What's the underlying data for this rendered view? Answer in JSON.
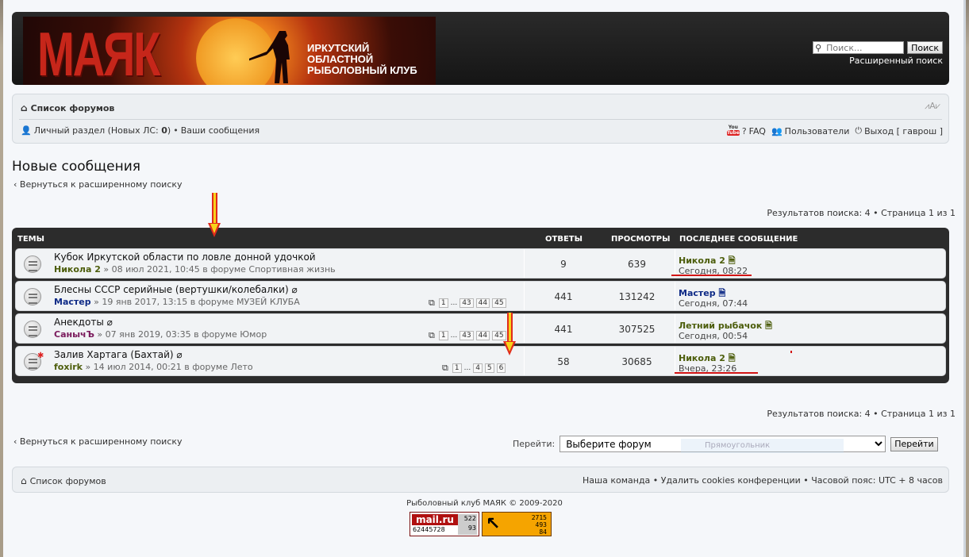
{
  "header": {
    "logo_text": "МАЯК",
    "club_line1": "ИРКУТСКИЙ ОБЛАСТНОЙ",
    "club_line2": "РЫБОЛОВНЫЙ КЛУБ",
    "search_placeholder": "Поиск...",
    "search_button": "Поиск",
    "advanced_search": "Расширенный поиск"
  },
  "nav": {
    "forum_list": "Список форумов",
    "font_control": "⩘A⩗",
    "private_section": "Личный раздел (Новых ЛС: ",
    "pm_count": "0",
    "private_close": ")",
    "bullet": "•",
    "your_posts": "Ваши сообщения",
    "youtube_top": "You",
    "youtube_bottom": "Tube",
    "faq": "FAQ",
    "users": "Пользователи",
    "logout": "Выход [ гаврош ]"
  },
  "page": {
    "title": "Новые сообщения",
    "back_link": "Вернуться к расширенному поиску",
    "results": "Результатов поиска: 4 • Страница 1 из 1"
  },
  "table": {
    "headers": {
      "topics": "ТЕМЫ",
      "replies": "ОТВЕТЫ",
      "views": "ПРОСМОТРЫ",
      "last_post": "ПОСЛЕДНЕЕ СООБЩЕНИЕ"
    },
    "rows": [
      {
        "title": "Кубок Иркутской области по ловле донной удочкой",
        "author": "Никола 2",
        "author_color": "#4c5d0b",
        "info": " » 08 июл 2021, 10:45 в форуме Спортивная жизнь",
        "pages": [],
        "replies": "9",
        "views": "639",
        "last_author": "Никола 2",
        "last_author_color": "#4c5d0b",
        "last_time": "Сегодня, 08:22"
      },
      {
        "title": "Блесны СССР серийные (вертушки/колебалки) ⌀",
        "author": "Мастер",
        "author_color": "#0e2a86",
        "info": " » 19 янв 2017, 13:15 в форуме МУЗЕЙ КЛУБА",
        "pages": [
          "1",
          "...",
          "43",
          "44",
          "45"
        ],
        "replies": "441",
        "views": "131242",
        "last_author": "Мастер",
        "last_author_color": "#0e2a86",
        "last_time": "Сегодня, 07:44"
      },
      {
        "title": "Анекдоты ⌀",
        "author": "СанычЪ",
        "author_color": "#7a1a5c",
        "info": " » 07 янв 2019, 03:35 в форуме Юмор",
        "pages": [
          "1",
          "...",
          "43",
          "44",
          "45"
        ],
        "replies": "441",
        "views": "307525",
        "last_author": "Летний рыбачок",
        "last_author_color": "#4c5d0b",
        "last_time": "Сегодня, 00:54"
      },
      {
        "title": "Залив Хартага (Бахтай) ⌀",
        "author": "foxirk",
        "author_color": "#4c5d0b",
        "info": " » 14 июл 2014, 00:21 в форуме Лето",
        "pages": [
          "1",
          "...",
          "4",
          "5",
          "6"
        ],
        "replies": "58",
        "views": "30685",
        "last_author": "Никола 2",
        "last_author_color": "#4c5d0b",
        "last_time": "Вчера, 23:26"
      }
    ]
  },
  "jump": {
    "label": "Перейти:",
    "selected": "Выберите форум",
    "button": "Перейти",
    "ghost_text": "Прямоугольник"
  },
  "footer": {
    "forum_list": "Список форумов",
    "links": "Наша команда • Удалить cookies конференции • Часовой пояс: UTC + 8 часов",
    "copyright": "Рыболовный клуб МАЯК © 2009-2020",
    "counter1_logo": "mail.ru",
    "counter1_id": "62445728",
    "counter1_a": "522",
    "counter1_b": "93",
    "counter2_a": "2715",
    "counter2_b": "493",
    "counter2_c": "84"
  }
}
